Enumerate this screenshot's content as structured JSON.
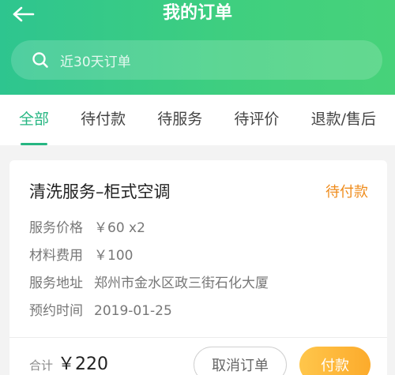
{
  "header": {
    "title": "我的订单",
    "back_icon": "arrow-left-icon"
  },
  "search": {
    "placeholder": "近30天订单",
    "icon": "search-icon"
  },
  "tabs": [
    {
      "label": "全部",
      "active": true
    },
    {
      "label": "待付款",
      "active": false
    },
    {
      "label": "待服务",
      "active": false
    },
    {
      "label": "待评价",
      "active": false
    },
    {
      "label": "退款/售后",
      "active": false
    }
  ],
  "order": {
    "title": "清洗服务–柜式空调",
    "status": "待付款",
    "fields": [
      {
        "label": "服务价格",
        "value": "￥60 x2"
      },
      {
        "label": "材料费用",
        "value": "￥100"
      },
      {
        "label": "服务地址",
        "value": "郑州市金水区政三街石化大厦"
      },
      {
        "label": "预约时间",
        "value": "2019-01-25"
      }
    ],
    "total_label": "合计",
    "total_value": "￥220",
    "cancel_label": "取消订单",
    "pay_label": "付款"
  },
  "colors": {
    "header_green": "#3fcf7f",
    "active_tab": "#26b682",
    "status_orange": "#ef8c1c",
    "pay_button": "#fcab2c"
  }
}
